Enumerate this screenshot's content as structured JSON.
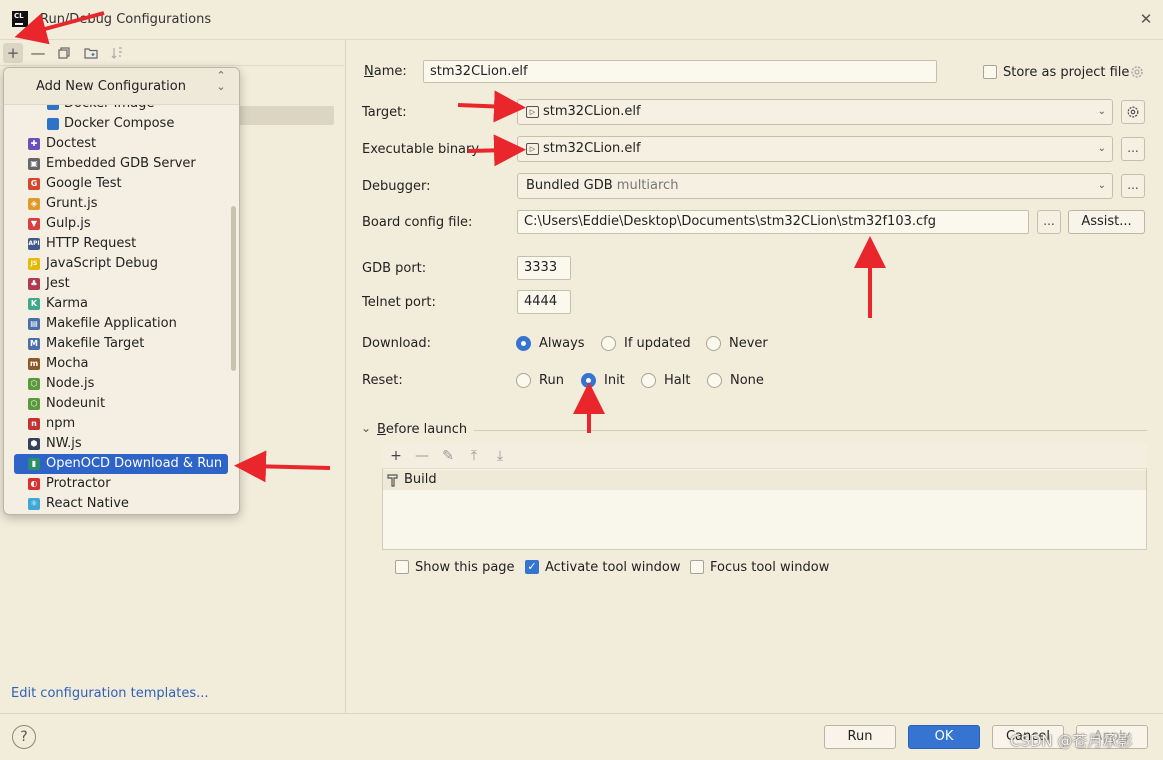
{
  "window": {
    "app_icon_text": "CL",
    "title": "Run/Debug Configurations",
    "close_symbol": "✕"
  },
  "left_toolbar": {
    "add_symbol": "+",
    "remove_symbol": "—",
    "icons": [
      "add-icon",
      "remove-icon",
      "copy-icon",
      "new-folder-icon",
      "sort-icon"
    ]
  },
  "popup": {
    "title": "Add New Configuration",
    "collapse_symbol": "⌃\n⌄",
    "items": [
      {
        "label": "Docker Image",
        "icon": "docker-icon",
        "color": "#2f73c9",
        "sub": true
      },
      {
        "label": "Docker Compose",
        "icon": "docker-icon",
        "color": "#2f73c9",
        "sub": true
      },
      {
        "label": "Doctest",
        "icon": "doctest-icon",
        "color": "#6b4fb8",
        "glyph": "✚"
      },
      {
        "label": "Embedded GDB Server",
        "icon": "chip-icon",
        "color": "#666666",
        "glyph": "▣"
      },
      {
        "label": "Google Test",
        "icon": "google-icon",
        "color": "#d8452f",
        "glyph": "G"
      },
      {
        "label": "Grunt.js",
        "icon": "grunt-icon",
        "color": "#e09a2a",
        "glyph": "◈"
      },
      {
        "label": "Gulp.js",
        "icon": "gulp-icon",
        "color": "#d84040",
        "glyph": "▼"
      },
      {
        "label": "HTTP Request",
        "icon": "api-icon",
        "color": "#3e5a8a",
        "glyph": "API"
      },
      {
        "label": "JavaScript Debug",
        "icon": "js-icon",
        "color": "#e7b800",
        "glyph": "JS"
      },
      {
        "label": "Jest",
        "icon": "jest-icon",
        "color": "#b13a53",
        "glyph": "♣"
      },
      {
        "label": "Karma",
        "icon": "karma-icon",
        "color": "#3fa88c",
        "glyph": "K"
      },
      {
        "label": "Makefile Application",
        "icon": "makefile-app-icon",
        "color": "#4a6fa8",
        "glyph": "▤"
      },
      {
        "label": "Makefile Target",
        "icon": "makefile-target-icon",
        "color": "#4a6fa8",
        "glyph": "M"
      },
      {
        "label": "Mocha",
        "icon": "mocha-icon",
        "color": "#8a5a2b",
        "glyph": "m"
      },
      {
        "label": "Node.js",
        "icon": "nodejs-icon",
        "color": "#5a9a3c",
        "glyph": "⬡"
      },
      {
        "label": "Nodeunit",
        "icon": "nodeunit-icon",
        "color": "#5a9a3c",
        "glyph": "⬡"
      },
      {
        "label": "npm",
        "icon": "npm-icon",
        "color": "#c33333",
        "glyph": "n"
      },
      {
        "label": "NW.js",
        "icon": "nwjs-icon",
        "color": "#33415c",
        "glyph": "⬢"
      },
      {
        "label": "OpenOCD Download & Run",
        "icon": "openocd-icon",
        "color": "#2a8f6a",
        "glyph": "▮",
        "selected": true
      },
      {
        "label": "Protractor",
        "icon": "protractor-icon",
        "color": "#d83030",
        "glyph": "◐"
      },
      {
        "label": "React Native",
        "icon": "react-icon",
        "color": "#3fa7d6",
        "glyph": "⚛"
      }
    ]
  },
  "left_footer": {
    "edit_templates": "Edit configuration templates..."
  },
  "form": {
    "name_label": "Name:",
    "name_value": "stm32CLion.elf",
    "store_label": "Store as project file",
    "target_label": "Target:",
    "target_value": "stm32CLion.elf",
    "exec_label": "Executable binary",
    "exec_value": "stm32CLion.elf",
    "debugger_label": "Debugger:",
    "debugger_value": "Bundled GDB",
    "debugger_suffix": "multiarch",
    "board_label": "Board config file:",
    "board_value": "C:\\Users\\Eddie\\Desktop\\Documents\\stm32CLion\\stm32f103.cfg",
    "assist_label": "Assist...",
    "ellipsis": "...",
    "gdb_port_label": "GDB port:",
    "gdb_port_value": "3333",
    "telnet_port_label": "Telnet port:",
    "telnet_port_value": "4444",
    "download_label": "Download:",
    "download_options": [
      "Always",
      "If updated",
      "Never"
    ],
    "download_selected": "Always",
    "reset_label": "Reset:",
    "reset_options": [
      "Run",
      "Init",
      "Halt",
      "None"
    ],
    "reset_selected": "Init",
    "file_icon_glyph": "▷"
  },
  "before_launch": {
    "title": "Before launch",
    "chevron": "⌄",
    "toolbar_glyphs": [
      "+",
      "—",
      "✎",
      "⤒",
      "⤓"
    ],
    "tasks": [
      "Build"
    ],
    "show_page": "Show this page",
    "activate_tool": "Activate tool window",
    "focus_tool": "Focus tool window",
    "checkmark": "✓"
  },
  "footer": {
    "help_symbol": "?",
    "run": "Run",
    "ok": "OK",
    "cancel": "Cancel",
    "apply": "Apply"
  },
  "watermark": "CSDN @苍月承影",
  "colors": {
    "accent": "#3574d0",
    "annotation_arrow": "#e8262b",
    "background": "#f2ecdb"
  }
}
